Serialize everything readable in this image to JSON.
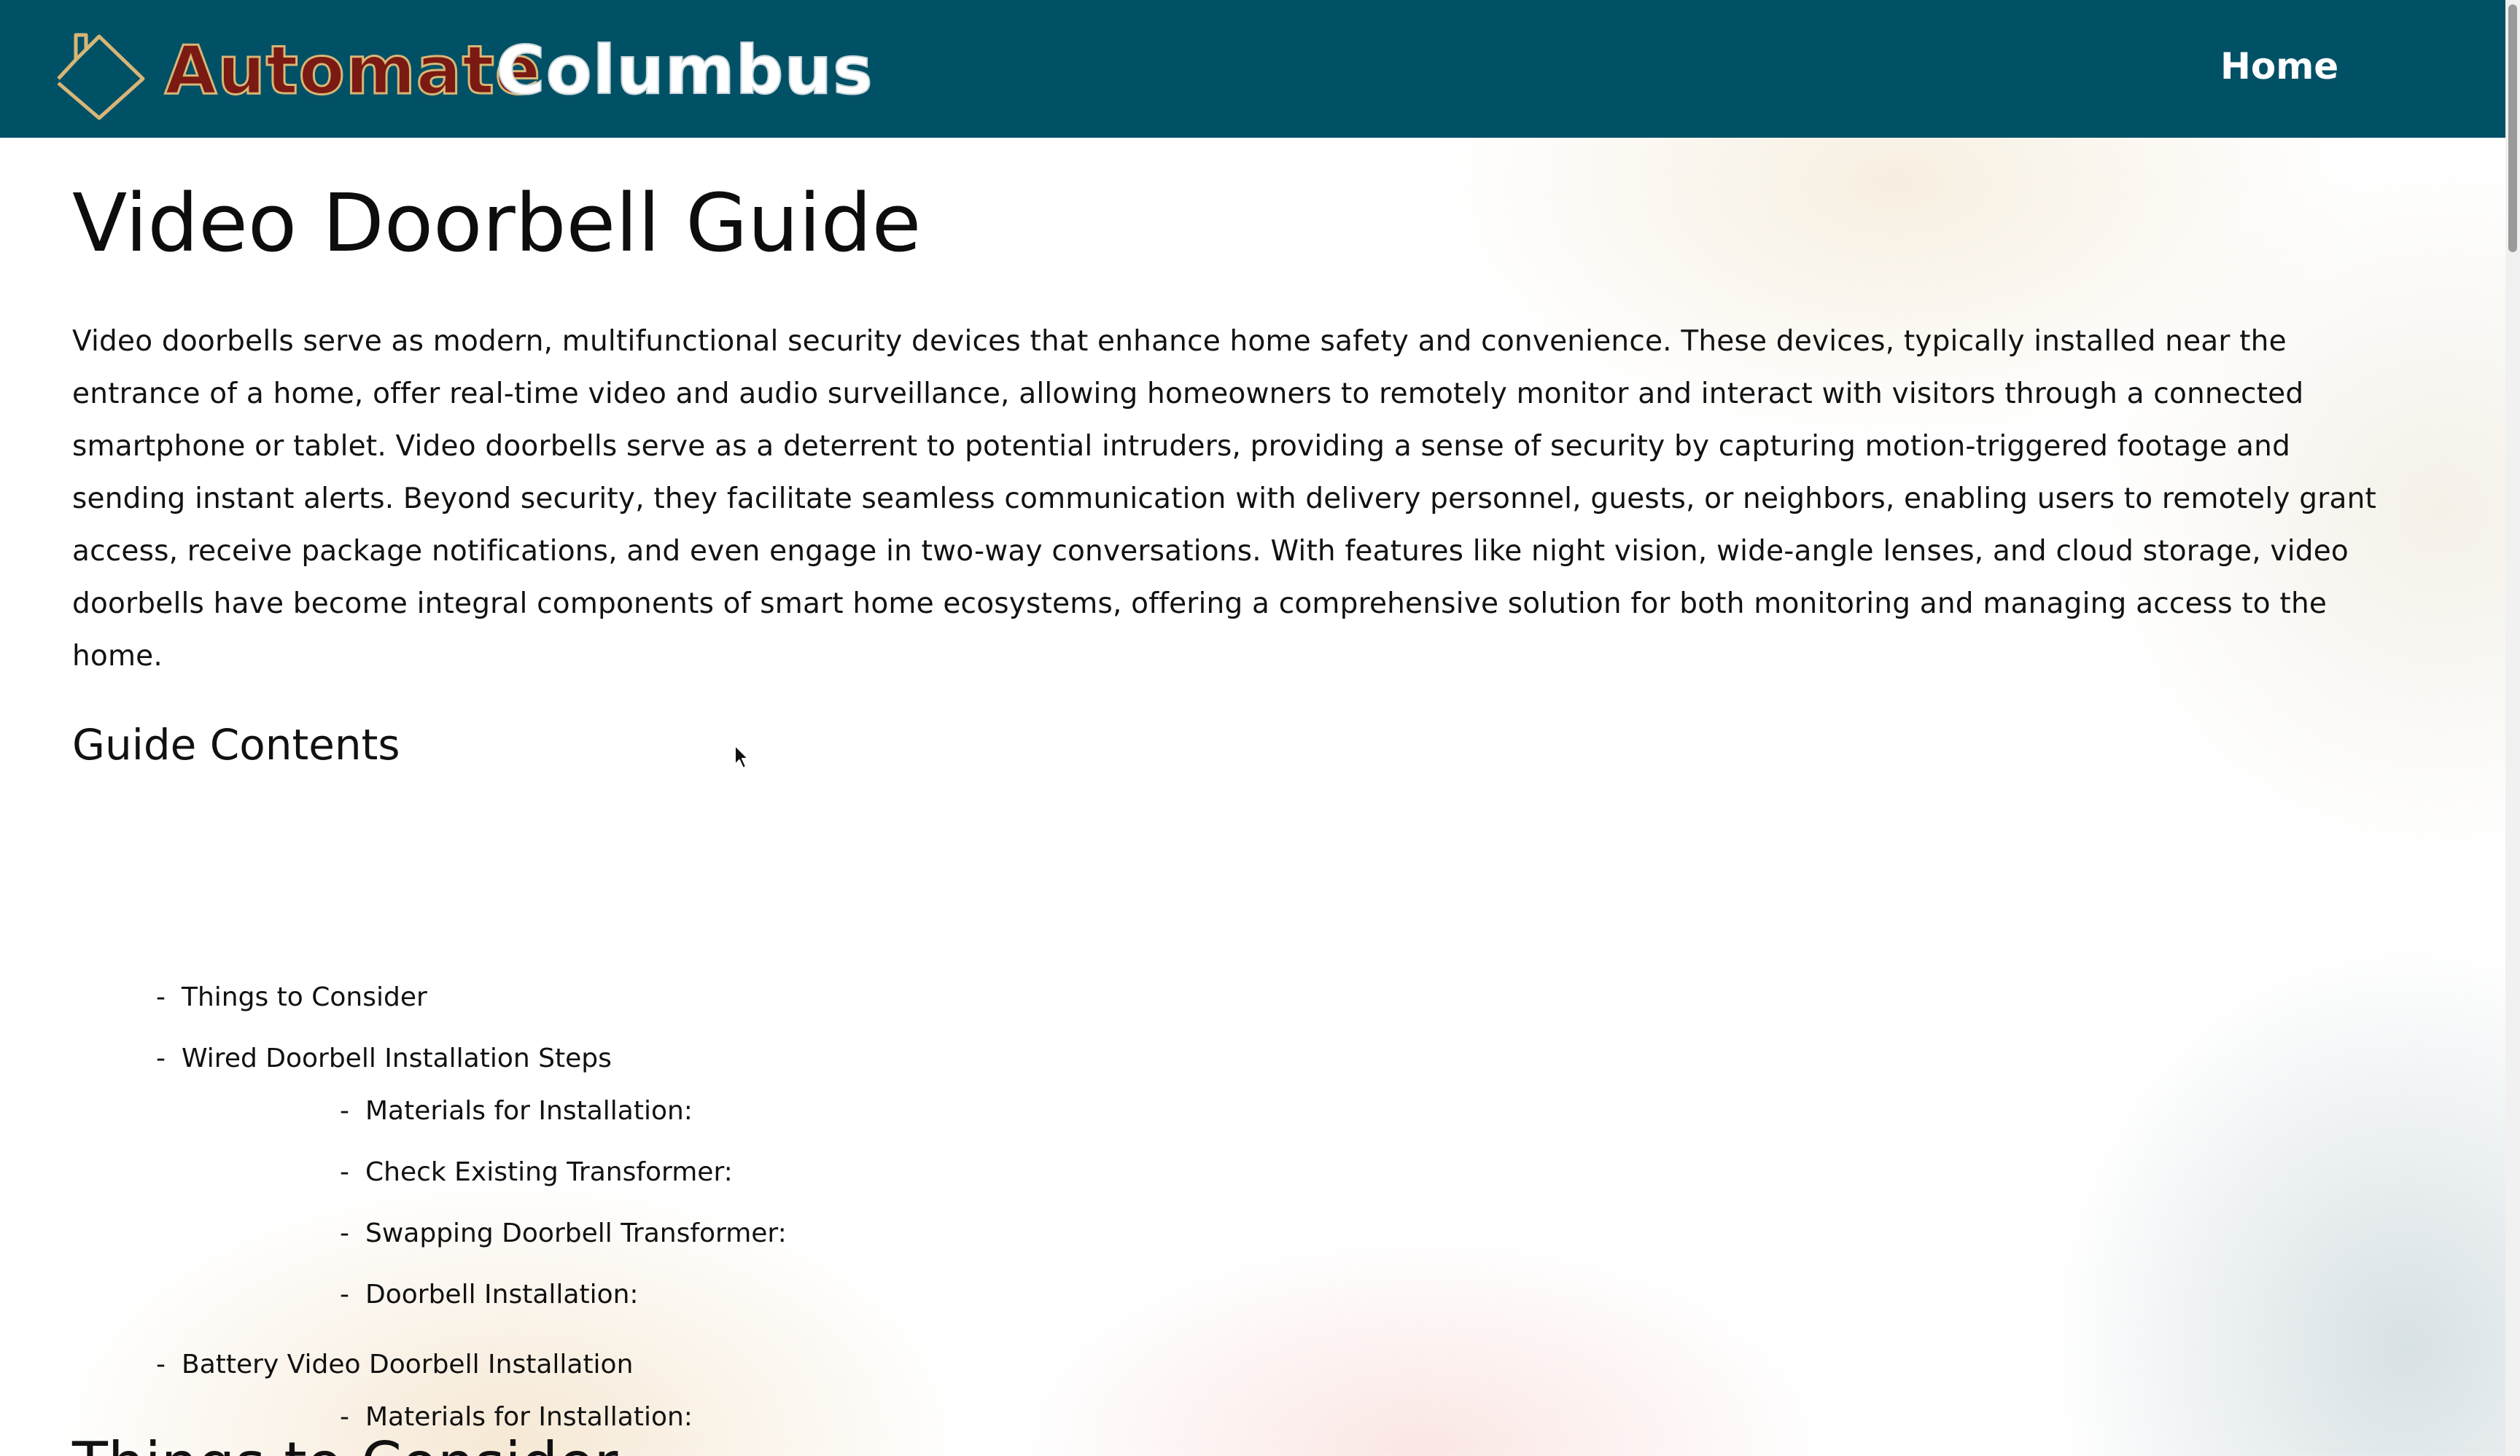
{
  "header": {
    "brand_part1": "Automate",
    "brand_part2": "Columbus",
    "logo_icon": "house-outline-icon",
    "nav_home": "Home",
    "colors": {
      "header_bg": "#005166",
      "brand_red": "#7a1a12",
      "brand_gold": "#d8b676"
    }
  },
  "main": {
    "title": "Video Doorbell Guide",
    "intro": "Video doorbells serve as modern, multifunctional security devices that enhance home safety and convenience. These devices, typically installed near the entrance of a home, offer real-time video and audio surveillance, allowing homeowners to remotely monitor and interact with visitors through a connected smartphone or tablet. Video doorbells serve as a deterrent to potential intruders, providing a sense of security by capturing motion-triggered footage and sending instant alerts. Beyond security, they facilitate seamless communication with delivery personnel, guests, or neighbors, enabling users to remotely grant access, receive package notifications, and even engage in two-way conversations. With features like night vision, wide-angle lenses, and cloud storage, video doorbells have become integral components of smart home ecosystems, offering a comprehensive solution for both monitoring and managing access to the home.",
    "toc_title": "Guide Contents",
    "toc": [
      {
        "label": "Things to Consider",
        "children": []
      },
      {
        "label": "Wired Doorbell Installation Steps",
        "children": [
          {
            "label": "Materials for Installation:"
          },
          {
            "label": "Check Existing Transformer:"
          },
          {
            "label": "Swapping Doorbell Transformer:"
          },
          {
            "label": "Doorbell Installation:"
          }
        ]
      },
      {
        "label": "Battery Video Doorbell Installation",
        "children": [
          {
            "label": "Materials for Installation:"
          }
        ]
      }
    ],
    "next_heading": "Things to Consider"
  }
}
